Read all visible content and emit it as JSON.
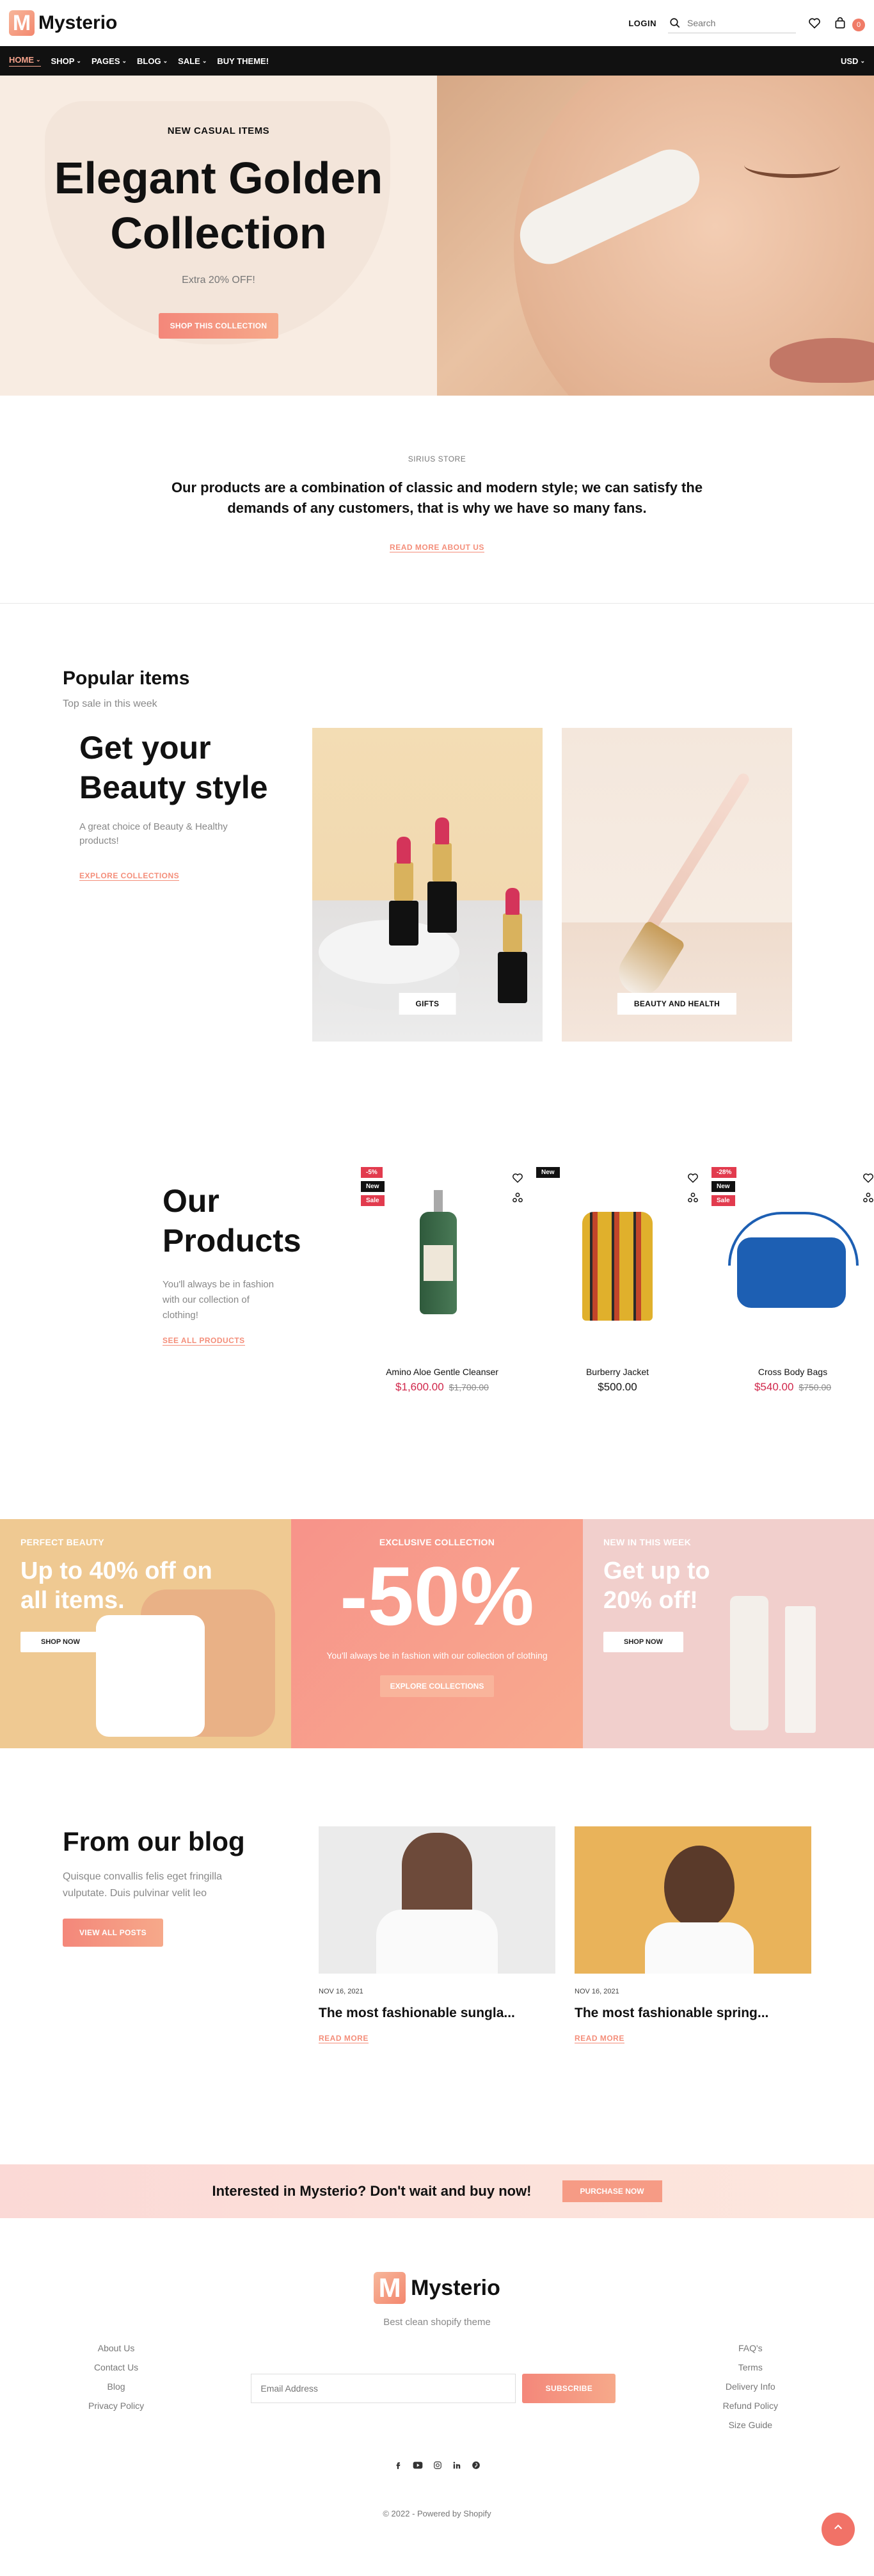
{
  "brand": {
    "name": "Mysterio",
    "mark": "M"
  },
  "header": {
    "login_label": "LOGIN",
    "search_placeholder": "Search",
    "cart_count": "0"
  },
  "nav": {
    "items": [
      {
        "label": "HOME",
        "caret": "⌄"
      },
      {
        "label": "SHOP",
        "caret": "⌄"
      },
      {
        "label": "PAGES",
        "caret": "⌄"
      },
      {
        "label": "BLOG",
        "caret": "⌄"
      },
      {
        "label": "SALE",
        "caret": "⌄"
      },
      {
        "label": "BUY THEME!",
        "caret": ""
      }
    ],
    "currency": "USD",
    "currency_caret": "⌄"
  },
  "hero": {
    "kicker": "NEW CASUAL ITEMS",
    "title": "Elegant Golden Collection",
    "subtitle": "Extra 20% OFF!",
    "button": "SHOP THIS COLLECTION"
  },
  "about": {
    "kicker": "SIRIUS STORE",
    "text": "Our products are a combination of classic and modern style; we can satisfy the demands of any customers, that is why we have so many fans.",
    "link": "READ MORE ABOUT US"
  },
  "popular": {
    "title": "Popular items",
    "subtitle": "Top sale in this week",
    "heading": "Get your Beauty style",
    "description": "A great choice of Beauty & Healthy products!",
    "link": "EXPLORE COLLECTIONS",
    "categories": [
      {
        "label": "GIFTS"
      },
      {
        "label": "BEAUTY AND HEALTH"
      }
    ]
  },
  "products": {
    "title": "Our Products",
    "description": "You'll always be in fashion with our collection of clothing!",
    "link": "SEE ALL PRODUCTS",
    "items": [
      {
        "name": "Amino Aloe Gentle Cleanser",
        "price": "$1,600.00",
        "old_price": "$1,700.00",
        "badges": [
          "-5%",
          "New",
          "Sale"
        ]
      },
      {
        "name": "Burberry Jacket",
        "price": "$500.00",
        "old_price": "",
        "badges": [
          "New"
        ]
      },
      {
        "name": "Cross Body Bags",
        "price": "$540.00",
        "old_price": "$750.00",
        "badges": [
          "-28%",
          "New",
          "Sale"
        ]
      }
    ]
  },
  "promos": [
    {
      "kicker": "PERFECT BEAUTY",
      "title": "Up to 40% off on all items.",
      "button": "SHOP NOW"
    },
    {
      "kicker": "EXCLUSIVE COLLECTION",
      "title": "-50%",
      "description": "You'll always be in fashion with our collection of clothing",
      "button": "EXPLORE COLLECTIONS"
    },
    {
      "kicker": "NEW IN THIS WEEK",
      "title": "Get up to 20% off!",
      "button": "SHOP NOW"
    }
  ],
  "blog": {
    "title": "From our blog",
    "description": "Quisque convallis felis eget fringilla vulputate. Duis pulvinar velit leo",
    "button": "VIEW ALL POSTS",
    "posts": [
      {
        "date": "NOV 16, 2021",
        "title": "The most fashionable sungla...",
        "link": "READ MORE"
      },
      {
        "date": "NOV 16, 2021",
        "title": "The most fashionable spring...",
        "link": "READ MORE"
      }
    ]
  },
  "cta": {
    "text": "Interested in Mysterio? Don't wait and buy now!",
    "button": "PURCHASE NOW"
  },
  "footer": {
    "tagline": "Best clean shopify theme",
    "left_links": [
      "About Us",
      "Contact Us",
      "Blog",
      "Privacy Policy"
    ],
    "right_links": [
      "FAQ's",
      "Terms",
      "Delivery Info",
      "Refund Policy",
      "Size Guide"
    ],
    "email_placeholder": "Email Address",
    "subscribe_button": "SUBSCRIBE",
    "copyright": "© 2022 - Powered by Shopify"
  },
  "colors": {
    "accent": "#f4877a",
    "sale": "#e23b4e",
    "nav_bg": "#111111"
  }
}
